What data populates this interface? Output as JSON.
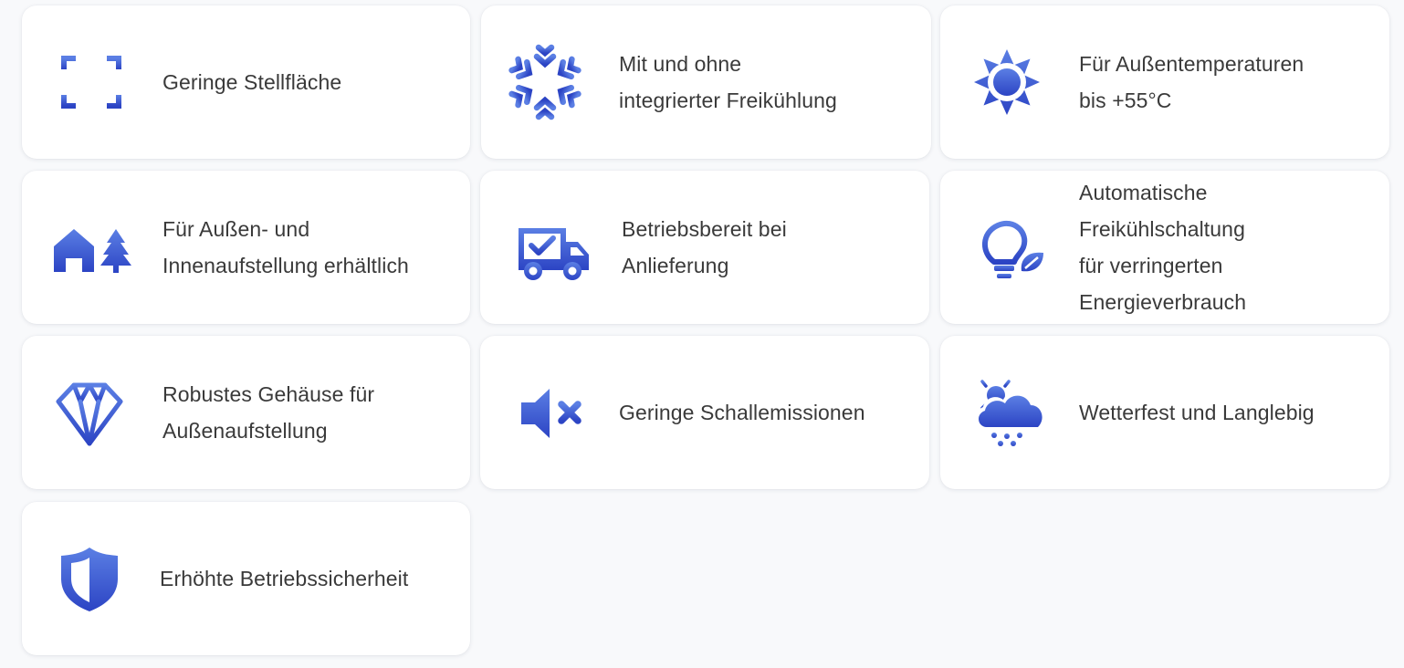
{
  "colors": {
    "icon_light": "#5b7fe4",
    "icon_dark": "#2c44c4",
    "text": "#3a3a3a",
    "card_bg": "#ffffff",
    "page_bg": "#f8f9fb"
  },
  "features": [
    {
      "icon": "frame-corners-icon",
      "text": "Geringe Stellfläche"
    },
    {
      "icon": "snowflake-icon",
      "text": "Mit und ohne\nintegrierter Freikühlung"
    },
    {
      "icon": "sun-icon",
      "text": "Für Außentemperaturen\nbis +55°C"
    },
    {
      "icon": "house-tree-icon",
      "text": "Für Außen- und\nInnenaufstellung erhältlich"
    },
    {
      "icon": "delivery-truck-check-icon",
      "text": "Betriebsbereit bei\nAnlieferung"
    },
    {
      "icon": "eco-lightbulb-icon",
      "text": "Automatische\nFreikühlschaltung\nfür verringerten\nEnergieverbrauch"
    },
    {
      "icon": "diamond-icon",
      "text": "Robustes Gehäuse für\nAußenaufstellung"
    },
    {
      "icon": "speaker-mute-icon",
      "text": "Geringe Schallemissionen"
    },
    {
      "icon": "weather-sun-cloud-icon",
      "text": "Wetterfest und Langlebig"
    },
    {
      "icon": "shield-icon",
      "text": "Erhöhte Betriebssicherheit"
    }
  ]
}
